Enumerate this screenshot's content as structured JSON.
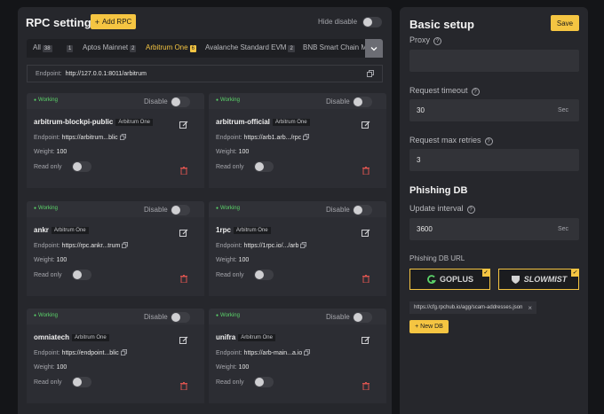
{
  "rpc": {
    "title": "RPC settings",
    "add_label": "Add RPC",
    "hide_disable_label": "Hide disable",
    "tabs": [
      {
        "label": "All",
        "count": "38"
      },
      {
        "label": "",
        "count": "1"
      },
      {
        "label": "Aptos Mainnet",
        "count": "2"
      },
      {
        "label": "Arbitrum One",
        "count": "6"
      },
      {
        "label": "Avalanche Standard EVM",
        "count": "2"
      },
      {
        "label": "BNB Smart Chain Mai",
        "count": ""
      }
    ],
    "endpoint_label": "Endpoint:",
    "endpoint_value": "http://127.0.0.1:8011/arbitrum",
    "cards": [
      {
        "status": "Working",
        "disable": "Disable",
        "name": "arbitrum-blockpi-public",
        "chain": "Arbitrum One",
        "endpoint_label": "Endpoint:",
        "endpoint": "https://arbitrum...blic",
        "weight_label": "Weight:",
        "weight": "100",
        "readonly_label": "Read only"
      },
      {
        "status": "Working",
        "disable": "Disable",
        "name": "arbitrum-official",
        "chain": "Arbitrum One",
        "endpoint_label": "Endpoint:",
        "endpoint": "https://arb1.arb.../rpc",
        "weight_label": "Weight:",
        "weight": "100",
        "readonly_label": "Read only"
      },
      {
        "status": "Working",
        "disable": "Disable",
        "name": "ankr",
        "chain": "Arbitrum One",
        "endpoint_label": "Endpoint:",
        "endpoint": "https://rpc.ankr...trum",
        "weight_label": "Weight:",
        "weight": "100",
        "readonly_label": "Read only"
      },
      {
        "status": "Working",
        "disable": "Disable",
        "name": "1rpc",
        "chain": "Arbitrum One",
        "endpoint_label": "Endpoint:",
        "endpoint": "https://1rpc.io/.../arb",
        "weight_label": "Weight:",
        "weight": "100",
        "readonly_label": "Read only"
      },
      {
        "status": "Working",
        "disable": "Disable",
        "name": "omniatech",
        "chain": "Arbitrum One",
        "endpoint_label": "Endpoint:",
        "endpoint": "https://endpoint...blic",
        "weight_label": "Weight:",
        "weight": "100",
        "readonly_label": "Read only"
      },
      {
        "status": "Working",
        "disable": "Disable",
        "name": "unifra",
        "chain": "Arbitrum One",
        "endpoint_label": "Endpoint:",
        "endpoint": "https://arb-main...a.io",
        "weight_label": "Weight:",
        "weight": "100",
        "readonly_label": "Read only"
      }
    ]
  },
  "setup": {
    "title": "Basic setup",
    "save_label": "Save",
    "proxy_label": "Proxy",
    "proxy_value": "",
    "timeout_label": "Request timeout",
    "timeout_value": "30",
    "timeout_unit": "Sec",
    "retries_label": "Request max retries",
    "retries_value": "3",
    "phishing_title": "Phishing DB",
    "interval_label": "Update interval",
    "interval_value": "3600",
    "interval_unit": "Sec",
    "url_label": "Phishing DB URL",
    "providers": [
      {
        "name": "GOPLUS",
        "icon": "goplus-icon"
      },
      {
        "name": "SLOWMIST",
        "icon": "slowmist-icon"
      }
    ],
    "db_url": "https://cfg.rpchub.io/agg/scam-addresses.json",
    "new_db_label": "+ New DB"
  },
  "colors": {
    "accent": "#f5c542",
    "working": "#5bd46a",
    "danger": "#d9534f"
  }
}
